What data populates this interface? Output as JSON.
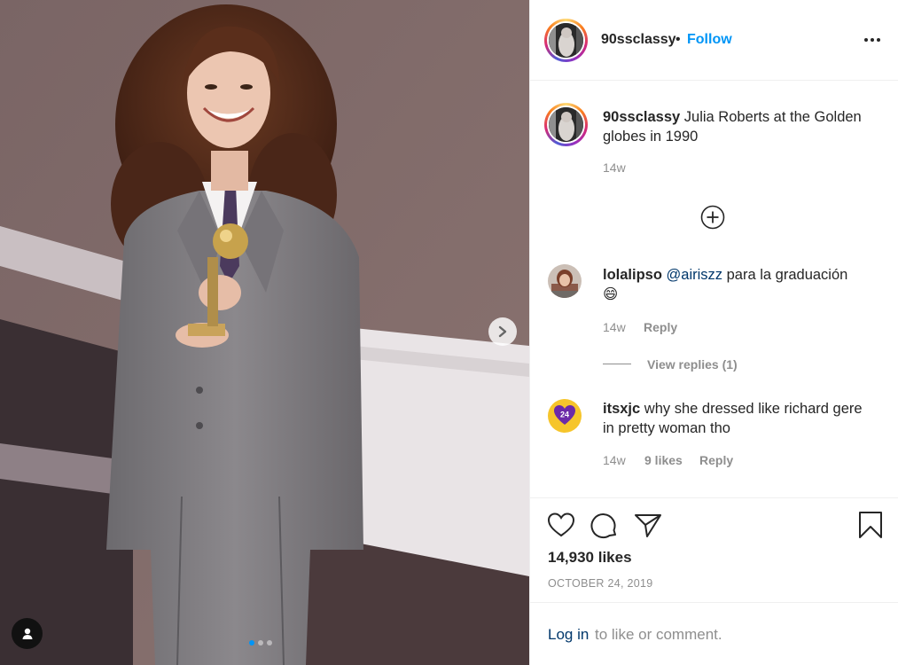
{
  "photo": {
    "carousel_total": 3,
    "carousel_active": 1
  },
  "post": {
    "username": "90ssclassy",
    "separator": "•",
    "follow_label": "Follow",
    "caption": "Julia Roberts at the Golden globes in 1990",
    "caption_age": "14w"
  },
  "comments": [
    {
      "username": "lolalipso",
      "mention": "@airiszz",
      "text": " para la graduación",
      "emoji": "😄",
      "age": "14w",
      "reply_label": "Reply",
      "view_replies": "View replies (1)"
    },
    {
      "username": "itsxjc",
      "text": "why she dressed like richard gere in pretty woman tho",
      "age": "14w",
      "likes": "9 likes",
      "reply_label": "Reply"
    }
  ],
  "stats": {
    "likes": "14,930 likes",
    "date": "OCTOBER 24, 2019"
  },
  "login": {
    "link": "Log in",
    "rest": "to like or comment."
  },
  "colors": {
    "accent": "#0095f6",
    "link": "#00376b",
    "muted": "#8e8e8e",
    "text": "#262626",
    "border": "#efefef"
  },
  "icons": {
    "heart": "heart-icon",
    "comment": "comment-icon",
    "share": "share-icon",
    "bookmark": "bookmark-icon",
    "add": "plus-circle-icon",
    "more": "more-horizontal-icon",
    "next": "chevron-right-icon",
    "tag": "user-tag-icon"
  }
}
